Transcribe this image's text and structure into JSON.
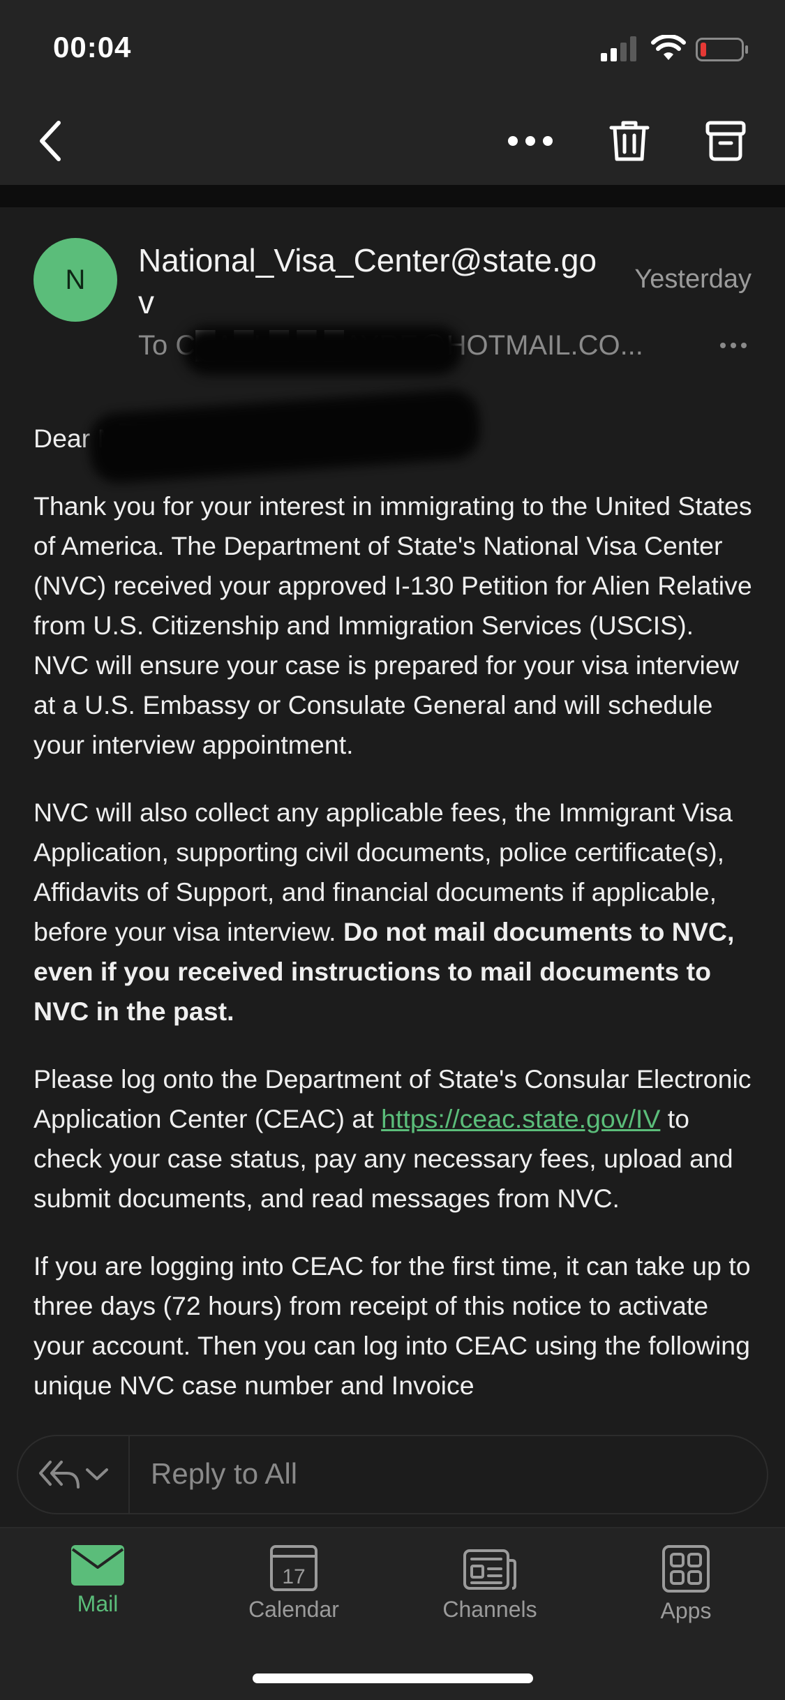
{
  "status_bar": {
    "time": "00:04",
    "icons": [
      "signal-icon",
      "wifi-icon",
      "battery-low-icon"
    ],
    "battery_color": "#e53935"
  },
  "toolbar": {
    "icons": [
      "chevron-left-icon",
      "more-horizontal-icon",
      "trash-icon",
      "archive-icon"
    ]
  },
  "email": {
    "avatar_initial": "N",
    "avatar_color": "#5bbd7a",
    "sender": "National_Visa_Center@state.gov",
    "date": "Yesterday",
    "recipient": "To C█A█L█ █ █AYRE@HOTMAIL.CO...",
    "greeting": "Dear M███ ███y█",
    "paragraph_1": "Thank you for your interest in immigrating to the United States of America. The Department of State's National Visa Center (NVC) received your approved I-130 Petition for Alien Relative from U.S. Citizenship and Immigration Services (USCIS). NVC will ensure your case is prepared for your visa interview at a U.S. Embassy or Consulate General and will schedule your interview appointment.",
    "paragraph_2_text": "NVC will also collect any applicable fees, the Immigrant Visa Application, supporting civil documents, police certificate(s), Affidavits of Support, and financial documents if applicable, before your visa interview. ",
    "paragraph_2_bold": "Do not mail documents to NVC, even if you received instructions to mail documents to NVC in the past.",
    "paragraph_3_pre": "Please log onto the Department of State's Consular Electronic Application Center (CEAC) at ",
    "paragraph_3_link": "https://ceac.state.gov/IV",
    "paragraph_3_post": " to check your case status, pay any necessary fees, upload and submit documents, and read messages from NVC.",
    "paragraph_4": "If you are logging into CEAC for the first time, it can take up to three days (72 hours) from receipt of this notice to activate your account. Then you can log into CEAC using the following unique NVC case number and Invoice"
  },
  "reply": {
    "placeholder": "Reply to All",
    "icons": [
      "reply-all-icon",
      "chevron-down-icon"
    ]
  },
  "tabs": [
    {
      "label": "Mail",
      "icon": "mail-icon",
      "active": true
    },
    {
      "label": "Calendar",
      "icon": "calendar-icon",
      "day": "17",
      "active": false
    },
    {
      "label": "Channels",
      "icon": "channels-icon",
      "active": false
    },
    {
      "label": "Apps",
      "icon": "apps-icon",
      "active": false
    }
  ],
  "colors": {
    "accent": "#5bbd7a",
    "background": "#1c1c1c",
    "secondary_text": "#9b9b9b"
  }
}
